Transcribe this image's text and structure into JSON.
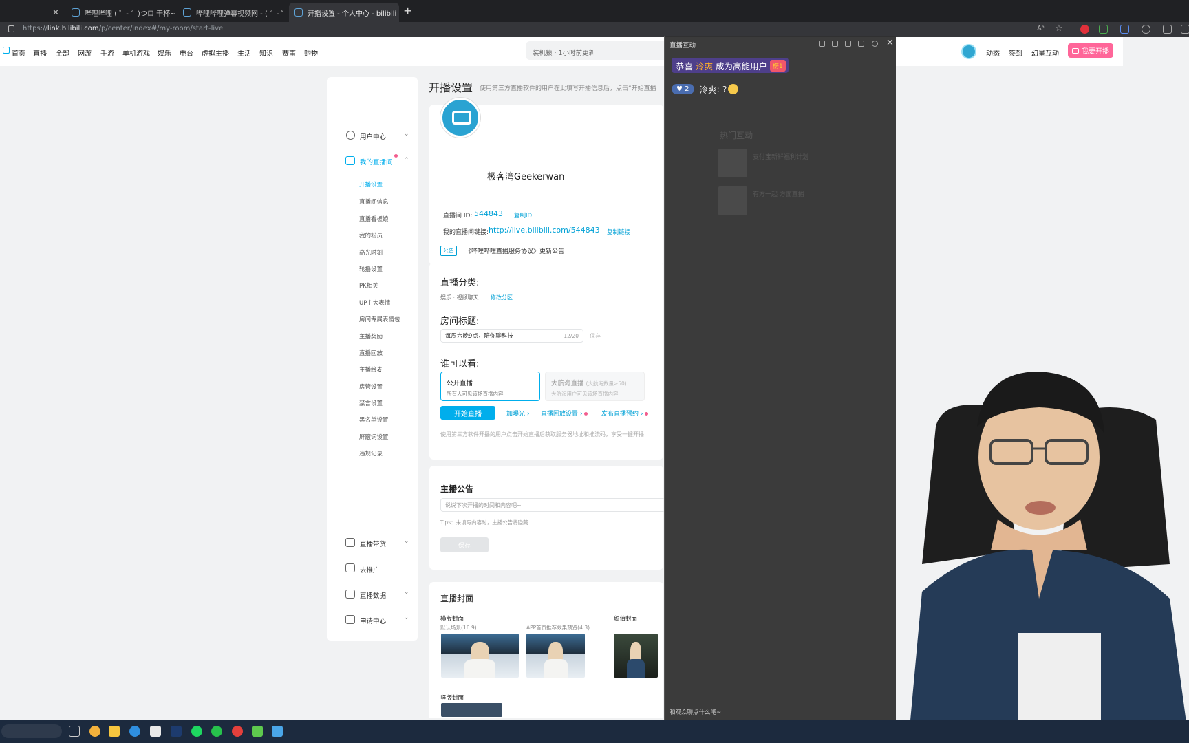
{
  "browser": {
    "tabs": [
      {
        "title": "",
        "active": false
      },
      {
        "title": "哔哩哔哩 ( ゜- ゜)つロ 干杯~-bili",
        "active": false
      },
      {
        "title": "哔哩哔哩弹幕视频网 - ( ゜- ゜)つ",
        "active": false
      },
      {
        "title": "开播设置 - 个人中心 - bilibili link",
        "active": true
      }
    ],
    "new_tab": "+",
    "url_prefix": "https://",
    "url_host": "link.bilibili.com",
    "url_path": "/p/center/index#/my-room/start-live"
  },
  "topnav": {
    "items": [
      "首页",
      "直播",
      "全部",
      "网游",
      "手游",
      "单机游戏",
      "娱乐",
      "电台",
      "虚拟主播",
      "生活",
      "知识",
      "赛事",
      "购物"
    ],
    "search_placeholder": "装机猿 · 1小时前更新",
    "user_items": [
      "动态",
      "签到",
      "幻星互动"
    ],
    "go_live": "我要开播"
  },
  "sidebar": {
    "user_center": "用户中心",
    "my_room": "我的直播间",
    "sub_items": [
      "开播设置",
      "直播间信息",
      "直播看板娘",
      "我的粉员",
      "高光时刻",
      "轮播设置",
      "PK相关",
      "UP主大表情",
      "房间专属表情包",
      "主播奖励",
      "直播回放",
      "主播绘麦",
      "房管设置",
      "禁言设置",
      "黑名单设置",
      "屏蔽词设置",
      "违规记录"
    ],
    "sales": "直播带货",
    "promote": "去推广",
    "data": "直播数据",
    "apply": "申请中心"
  },
  "main": {
    "page_title": "开播设置",
    "page_desc": "使用第三方直播软件的用户在此填写开播信息后，点击“开始直播",
    "streamer_name": "极客湾Geekerwan",
    "room_id_label": "直播间 ID:",
    "room_id": "544843",
    "copy_id": "复制ID",
    "room_link_label": "我的直播间链接:",
    "room_link": "http://live.bilibili.com/544843",
    "copy_link": "复制链接",
    "notice_tag": "公告",
    "notice_text": "《哔哩哔哩直播服务协议》更新公告",
    "category_title": "直播分类:",
    "category_value": "娱乐 · 视频聊天",
    "change_category": "修改分区",
    "room_title_label": "房间标题:",
    "room_title_value": "每周六晚9点，陪你聊科技",
    "room_title_count": "12/20",
    "room_title_save": "保存",
    "who_title": "谁可以看:",
    "public_title": "公开直播",
    "public_desc": "所有人可见该场直播内容",
    "guard_title": "大航海直播",
    "guard_hint": "(大航海数量≥50)",
    "guard_desc": "大航海用户可见该场直播内容",
    "start_live": "开始直播",
    "boost": "加曝光",
    "replay_settings": "直播回放设置",
    "publish_reserve": "发布直播预约",
    "third_party_note": "使用第三方软件开播的用户点击开始直播后获取服务器地址和推流码，享受一键开播",
    "announcement_title": "主播公告",
    "announcement_placeholder": "说说下次开播的时间和内容吧~",
    "announcement_tips": "Tips：未填写内容时，主播公告将隐藏",
    "announcement_save": "保存",
    "cover_title": "直播封面",
    "landscape_cover": "横版封面",
    "landscape_default": "默认场景(16:9)",
    "app_preview": "APP首页推荐效果预览(4:3)",
    "face_cover": "颜值封面",
    "portrait_cover": "竖版封面"
  },
  "chat": {
    "title": "直播互动",
    "congrats_prefix": "恭喜",
    "congrats_name": "泠爽",
    "congrats_suffix": "成为高能用户",
    "congrats_badge": "榜1",
    "message_level": "2",
    "message_user": "泠爽",
    "message_text": ": ?",
    "ghost_hot": "热门互动",
    "ghost_item1": "支付宝新鲜福利计划",
    "ghost_item2": "有方一起 方面直播",
    "input_placeholder": "和观众聊点什么吧~"
  },
  "colors": {
    "accent": "#00aeec",
    "pink": "#ff6699",
    "chat_bg": "#303030"
  }
}
